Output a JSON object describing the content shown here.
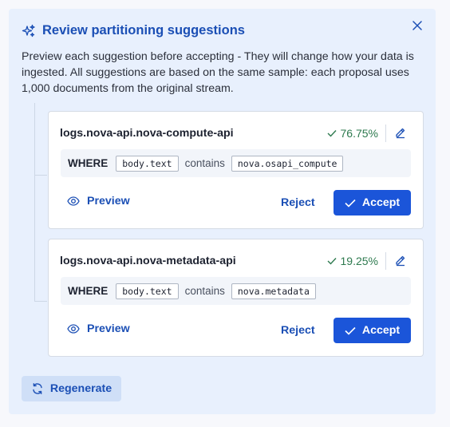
{
  "header": {
    "title": "Review partitioning suggestions",
    "description": "Preview each suggestion before accepting - They will change how your data is ingested. All suggestions are based on the same sample: each proposal uses 1,000 documents from the original stream."
  },
  "cards": [
    {
      "name": "logs.nova-api.nova-compute-api",
      "percent": "76.75%",
      "where": "WHERE",
      "field": "body.text",
      "operator": "contains",
      "value": "nova.osapi_compute",
      "preview_label": "Preview",
      "reject_label": "Reject",
      "accept_label": "Accept"
    },
    {
      "name": "logs.nova-api.nova-metadata-api",
      "percent": "19.25%",
      "where": "WHERE",
      "field": "body.text",
      "operator": "contains",
      "value": "nova.metadata",
      "preview_label": "Preview",
      "reject_label": "Reject",
      "accept_label": "Accept"
    }
  ],
  "footer": {
    "regenerate_label": "Regenerate"
  },
  "icons": {
    "title": "sparkles-icon",
    "close": "close-icon",
    "percent": "check-icon",
    "edit": "pencil-icon",
    "preview": "eye-icon",
    "accept": "check-icon",
    "regenerate": "refresh-icon"
  },
  "colors": {
    "accent": "#1b55d9",
    "title": "#1b4fb5",
    "success": "#2e7a4f",
    "panel_bg": "#e8f0fd"
  }
}
